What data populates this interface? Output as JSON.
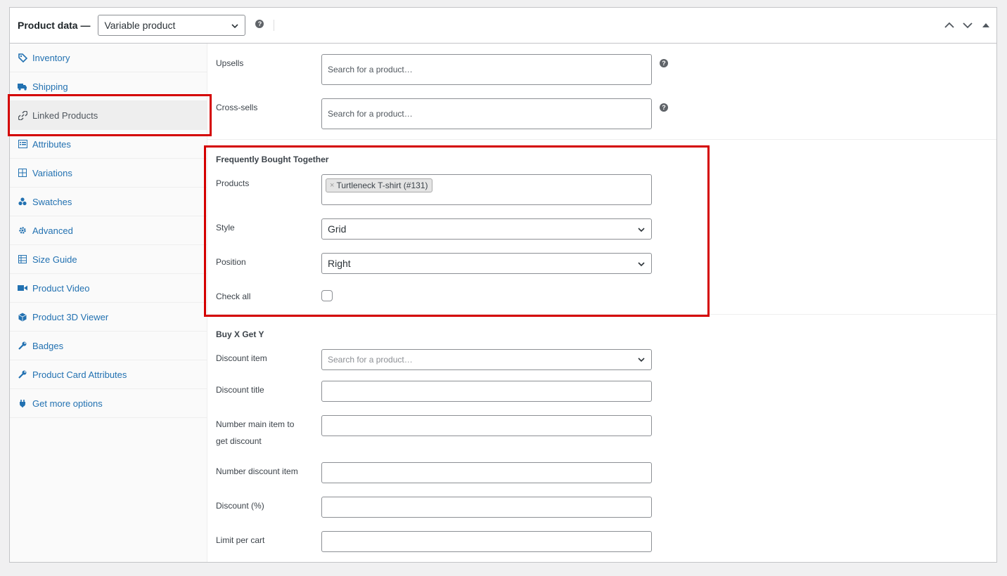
{
  "header": {
    "title": "Product data —",
    "product_type": "Variable product",
    "help_glyph": "?"
  },
  "tabs": [
    {
      "label": "Inventory",
      "icon": "tag-icon"
    },
    {
      "label": "Shipping",
      "icon": "truck-icon"
    },
    {
      "label": "Linked Products",
      "icon": "link-icon",
      "active": true
    },
    {
      "label": "Attributes",
      "icon": "list-icon"
    },
    {
      "label": "Variations",
      "icon": "grid-icon"
    },
    {
      "label": "Swatches",
      "icon": "swatches-icon"
    },
    {
      "label": "Advanced",
      "icon": "gear-icon"
    },
    {
      "label": "Size Guide",
      "icon": "table-icon"
    },
    {
      "label": "Product Video",
      "icon": "video-icon"
    },
    {
      "label": "Product 3D Viewer",
      "icon": "cube-icon"
    },
    {
      "label": "Badges",
      "icon": "wrench-icon"
    },
    {
      "label": "Product Card Attributes",
      "icon": "wrench-icon"
    },
    {
      "label": "Get more options",
      "icon": "plugin-icon"
    }
  ],
  "linked": {
    "upsells_label": "Upsells",
    "upsells_placeholder": "Search for a product…",
    "crosssells_label": "Cross-sells",
    "crosssells_placeholder": "Search for a product…"
  },
  "fbt": {
    "title": "Frequently Bought Together",
    "products_label": "Products",
    "product_token": "Turtleneck T-shirt (#131)",
    "token_remove": "×",
    "style_label": "Style",
    "style_value": "Grid",
    "position_label": "Position",
    "position_value": "Right",
    "checkall_label": "Check all",
    "checkall_checked": false
  },
  "bxgy": {
    "title": "Buy X Get Y",
    "discount_item_label": "Discount item",
    "discount_item_placeholder": "Search for a product…",
    "discount_title_label": "Discount title",
    "main_item_label_line1": "Number main item to",
    "main_item_label_line2": "get discount",
    "number_discount_label": "Number discount item",
    "discount_percent_label": "Discount (%)",
    "limit_label": "Limit per cart"
  },
  "colors": {
    "link": "#2271b1",
    "highlight": "#d40000"
  }
}
